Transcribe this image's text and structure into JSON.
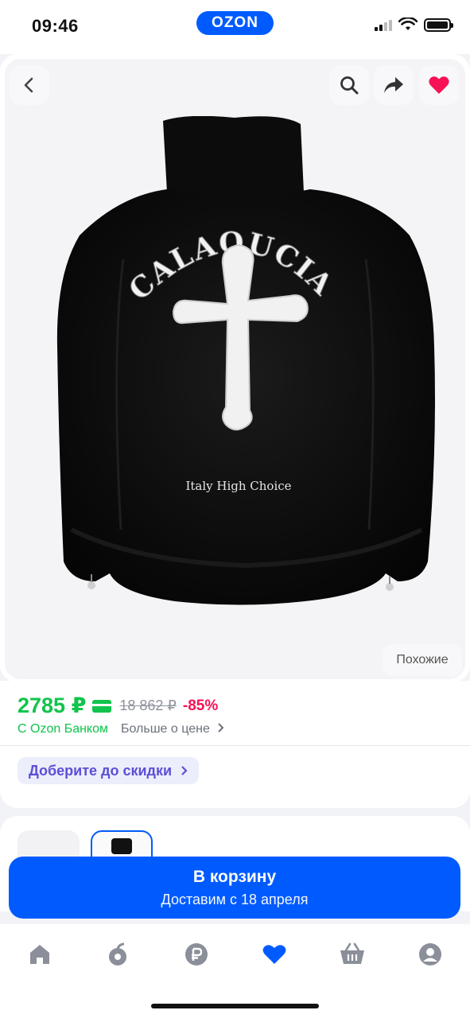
{
  "status_bar": {
    "time": "09:46",
    "logo": "OZON"
  },
  "product": {
    "buttons": {
      "similar": "Похожие"
    },
    "image": {
      "arch_text": "CALAOUCIA",
      "bottom_text": "Italy High Choice"
    }
  },
  "price": {
    "current": "2785 ₽",
    "old": "18 862 ₽",
    "discount": "-85%",
    "bank_label": "С Ozon Банком",
    "more_label": "Больше о цене",
    "promo_label": "Доберите до скидки"
  },
  "cart": {
    "title": "В корзину",
    "subtitle": "Доставим с 18 апреля"
  },
  "nav": {
    "items": [
      "home-icon",
      "fresh-icon",
      "ruble-icon",
      "favorites-icon",
      "cart-icon",
      "profile-icon"
    ]
  },
  "colors": {
    "accent": "#005bff",
    "price_green": "#10c44c",
    "discount_pink": "#f91155",
    "promo_purple": "#5b4fd6"
  }
}
